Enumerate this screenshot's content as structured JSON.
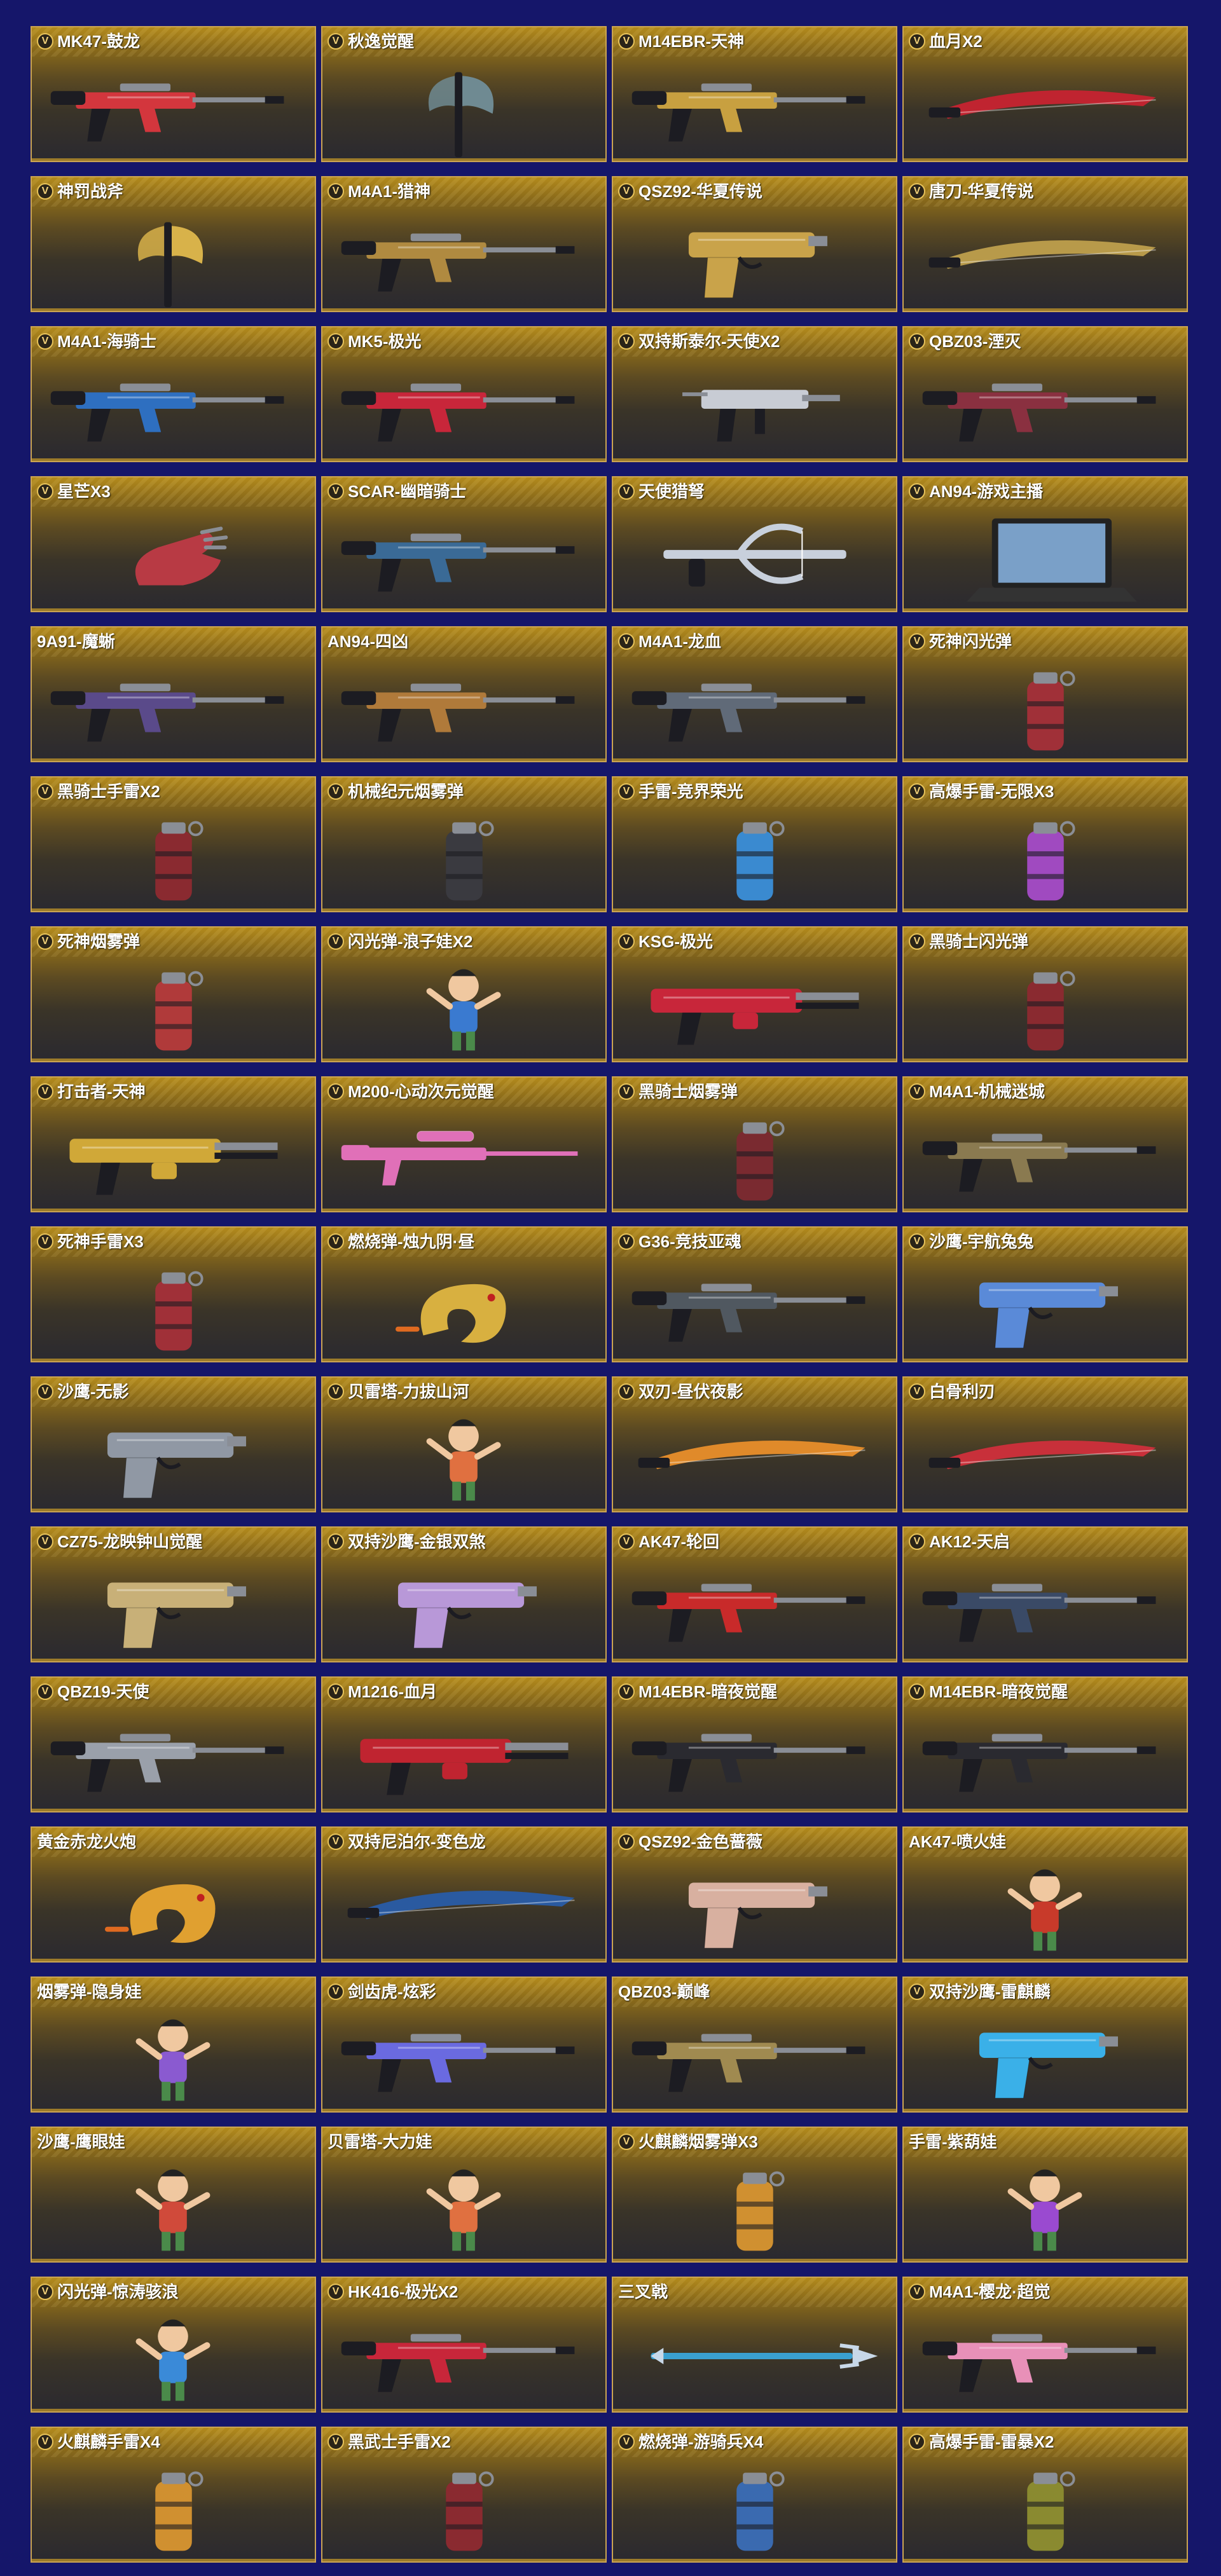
{
  "items": [
    {
      "name": "MK47-鼓龙",
      "vip": true,
      "kind": "rifle",
      "color": "#d3363d"
    },
    {
      "name": "秋逸觉醒",
      "vip": true,
      "kind": "axe",
      "color": "#6f8a92"
    },
    {
      "name": "M14EBR-天神",
      "vip": true,
      "kind": "rifle",
      "color": "#c8a040"
    },
    {
      "name": "血月X2",
      "vip": true,
      "kind": "blade",
      "color": "#c02430"
    },
    {
      "name": "神罚战斧",
      "vip": true,
      "kind": "axe",
      "color": "#d8b24a"
    },
    {
      "name": "M4A1-猎神",
      "vip": true,
      "kind": "rifle",
      "color": "#b08a40"
    },
    {
      "name": "QSZ92-华夏传说",
      "vip": true,
      "kind": "pistol",
      "color": "#c9a34a"
    },
    {
      "name": "唐刀-华夏传说",
      "vip": true,
      "kind": "blade",
      "color": "#b89a4a"
    },
    {
      "name": "M4A1-海骑士",
      "vip": true,
      "kind": "rifle",
      "color": "#2e6fc0"
    },
    {
      "name": "MK5-极光",
      "vip": true,
      "kind": "rifle",
      "color": "#c8263a"
    },
    {
      "name": "双持斯泰尔-天使X2",
      "vip": true,
      "kind": "smg",
      "color": "#c8ccd4"
    },
    {
      "name": "QBZ03-湮灭",
      "vip": true,
      "kind": "rifle",
      "color": "#8a3040"
    },
    {
      "name": "星芒X3",
      "vip": true,
      "kind": "glove",
      "color": "#b83a44"
    },
    {
      "name": "SCAR-幽暗骑士",
      "vip": true,
      "kind": "rifle",
      "color": "#3a6a96"
    },
    {
      "name": "天使猎弩",
      "vip": true,
      "kind": "bow",
      "color": "#c8d0dc"
    },
    {
      "name": "AN94-游戏主播",
      "vip": true,
      "kind": "laptop",
      "color": "#7aa0c8"
    },
    {
      "name": "9A91-魔蜥",
      "vip": false,
      "kind": "rifle",
      "color": "#5a4a8a"
    },
    {
      "name": "AN94-四凶",
      "vip": false,
      "kind": "rifle",
      "color": "#b07a3a"
    },
    {
      "name": "M4A1-龙血",
      "vip": true,
      "kind": "rifle",
      "color": "#606a78"
    },
    {
      "name": "死神闪光弹",
      "vip": true,
      "kind": "grenade",
      "color": "#a03038"
    },
    {
      "name": "黑骑士手雷X2",
      "vip": true,
      "kind": "grenade",
      "color": "#8a2a30"
    },
    {
      "name": "机械纪元烟雾弹",
      "vip": true,
      "kind": "grenade",
      "color": "#3a3a40"
    },
    {
      "name": "手雷-竞界荣光",
      "vip": true,
      "kind": "grenade",
      "color": "#3a8ad0"
    },
    {
      "name": "高爆手雷-无限X3",
      "vip": true,
      "kind": "grenade",
      "color": "#a04ac0"
    },
    {
      "name": "死神烟雾弹",
      "vip": true,
      "kind": "grenade",
      "color": "#b03a3a"
    },
    {
      "name": "闪光弹-浪子娃X2",
      "vip": true,
      "kind": "character",
      "color": "#3a7ad0"
    },
    {
      "name": "KSG-极光",
      "vip": true,
      "kind": "shotgun",
      "color": "#c8263a"
    },
    {
      "name": "黑骑士闪光弹",
      "vip": true,
      "kind": "grenade",
      "color": "#8a2a30"
    },
    {
      "name": "打击者-天神",
      "vip": true,
      "kind": "shotgun",
      "color": "#d0a838"
    },
    {
      "name": "M200-心动次元觉醒",
      "vip": true,
      "kind": "sniper",
      "color": "#e070b8"
    },
    {
      "name": "黑骑士烟雾弹",
      "vip": true,
      "kind": "grenade",
      "color": "#7a2a30"
    },
    {
      "name": "M4A1-机械迷城",
      "vip": true,
      "kind": "rifle",
      "color": "#8a7a50"
    },
    {
      "name": "死神手雷X3",
      "vip": true,
      "kind": "grenade",
      "color": "#a03038"
    },
    {
      "name": "燃烧弹-烛九阴·昼",
      "vip": true,
      "kind": "dragon",
      "color": "#d8b040"
    },
    {
      "name": "G36-竞技亚魂",
      "vip": true,
      "kind": "rifle",
      "color": "#505860"
    },
    {
      "name": "沙鹰-宇航兔兔",
      "vip": true,
      "kind": "pistol",
      "color": "#5a8ad8"
    },
    {
      "name": "沙鹰-无影",
      "vip": true,
      "kind": "pistol",
      "color": "#9098a4"
    },
    {
      "name": "贝雷塔-力拔山河",
      "vip": true,
      "kind": "character",
      "color": "#e07040"
    },
    {
      "name": "双刃-昼伏夜影",
      "vip": true,
      "kind": "blade",
      "color": "#e08a2a"
    },
    {
      "name": "白骨利刃",
      "vip": true,
      "kind": "blade",
      "color": "#c8303a"
    },
    {
      "name": "CZ75-龙映钟山觉醒",
      "vip": true,
      "kind": "pistol",
      "color": "#c8b078"
    },
    {
      "name": "双持沙鹰-金银双煞",
      "vip": true,
      "kind": "pistol",
      "color": "#b898d8"
    },
    {
      "name": "AK47-轮回",
      "vip": true,
      "kind": "rifle",
      "color": "#c82a2a"
    },
    {
      "name": "AK12-天启",
      "vip": true,
      "kind": "rifle",
      "color": "#3a4a66"
    },
    {
      "name": "QBZ19-天使",
      "vip": true,
      "kind": "rifle",
      "color": "#9aa0aa"
    },
    {
      "name": "M1216-血月",
      "vip": true,
      "kind": "shotgun",
      "color": "#c02430"
    },
    {
      "name": "M14EBR-暗夜觉醒",
      "vip": true,
      "kind": "rifle",
      "color": "#2a2a30"
    },
    {
      "name": "M14EBR-暗夜觉醒",
      "vip": true,
      "kind": "rifle",
      "color": "#2a2a30"
    },
    {
      "name": "黄金赤龙火炮",
      "vip": false,
      "kind": "dragon",
      "color": "#e0a030"
    },
    {
      "name": "双持尼泊尔-变色龙",
      "vip": true,
      "kind": "blade",
      "color": "#2a5aa0"
    },
    {
      "name": "QSZ92-金色蔷薇",
      "vip": true,
      "kind": "pistol",
      "color": "#d8b0a0"
    },
    {
      "name": "AK47-喷火娃",
      "vip": false,
      "kind": "character",
      "color": "#c83a2a"
    },
    {
      "name": "烟雾弹-隐身娃",
      "vip": false,
      "kind": "character",
      "color": "#8a5ad0"
    },
    {
      "name": "剑齿虎-炫彩",
      "vip": true,
      "kind": "rifle",
      "color": "#6a6ae0"
    },
    {
      "name": "QBZ03-巅峰",
      "vip": false,
      "kind": "rifle",
      "color": "#a08a50"
    },
    {
      "name": "双持沙鹰-雷麒麟",
      "vip": true,
      "kind": "pistol",
      "color": "#3ab0e8"
    },
    {
      "name": "沙鹰-鹰眼娃",
      "vip": false,
      "kind": "character",
      "color": "#d04a3a"
    },
    {
      "name": "贝雷塔-大力娃",
      "vip": false,
      "kind": "character",
      "color": "#e07040"
    },
    {
      "name": "火麒麟烟雾弹X3",
      "vip": true,
      "kind": "grenade",
      "color": "#d09030"
    },
    {
      "name": "手雷-紫葫娃",
      "vip": false,
      "kind": "character",
      "color": "#9a4ad0"
    },
    {
      "name": "闪光弹-惊涛骇浪",
      "vip": true,
      "kind": "character",
      "color": "#3a8ad8"
    },
    {
      "name": "HK416-极光X2",
      "vip": true,
      "kind": "rifle",
      "color": "#c8263a"
    },
    {
      "name": "三叉戟",
      "vip": false,
      "kind": "spear",
      "color": "#3aa0d0"
    },
    {
      "name": "M4A1-樱龙·超觉",
      "vip": true,
      "kind": "rifle",
      "color": "#e890b8"
    },
    {
      "name": "火麒麟手雷X4",
      "vip": true,
      "kind": "grenade",
      "color": "#d09030"
    },
    {
      "name": "黑武士手雷X2",
      "vip": true,
      "kind": "grenade",
      "color": "#8a2a30"
    },
    {
      "name": "燃烧弹-游骑兵X4",
      "vip": true,
      "kind": "grenade",
      "color": "#3a6ab0"
    },
    {
      "name": "高爆手雷-雷暴X2",
      "vip": true,
      "kind": "grenade",
      "color": "#8a8a30"
    }
  ]
}
